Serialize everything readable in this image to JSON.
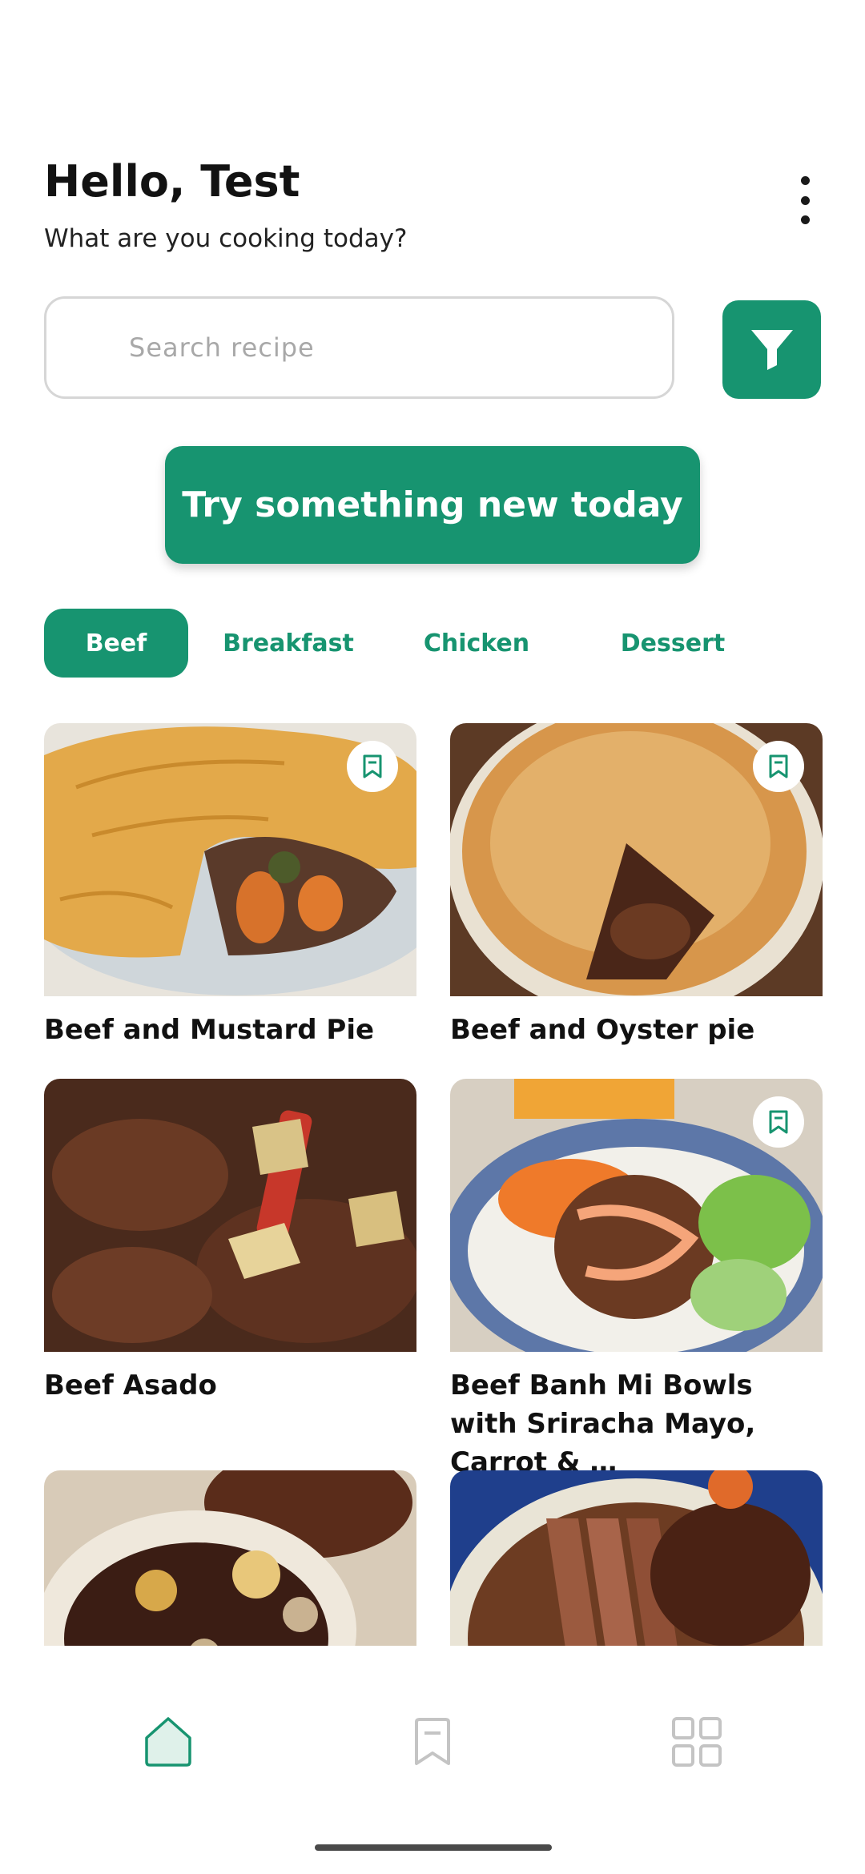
{
  "header": {
    "greeting": "Hello, Test",
    "subtitle": "What are you cooking today?"
  },
  "search": {
    "placeholder": "Search recipe"
  },
  "cta": {
    "label": "Try something new today"
  },
  "categories": [
    "Beef",
    "Breakfast",
    "Chicken",
    "Dessert"
  ],
  "selected_category": "Beef",
  "recipes": [
    {
      "title": "Beef and Mustard Pie",
      "bookmark": true
    },
    {
      "title": "Beef and Oyster pie",
      "bookmark": true
    },
    {
      "title": "Beef Asado",
      "bookmark": false
    },
    {
      "title": "Beef Banh Mi Bowls with Sriracha Mayo, Carrot & …",
      "bookmark": true
    },
    {
      "title": "",
      "bookmark": false
    },
    {
      "title": "",
      "bookmark": false
    }
  ],
  "icons": {
    "menu": "more-vertical-icon",
    "filter": "filter-icon",
    "bookmark": "bookmark-icon",
    "nav_home": "home-icon",
    "nav_saved": "bookmark-icon",
    "nav_categories": "grid-icon"
  },
  "colors": {
    "accent": "#179470",
    "nav_inactive": "#c4c4c4"
  }
}
